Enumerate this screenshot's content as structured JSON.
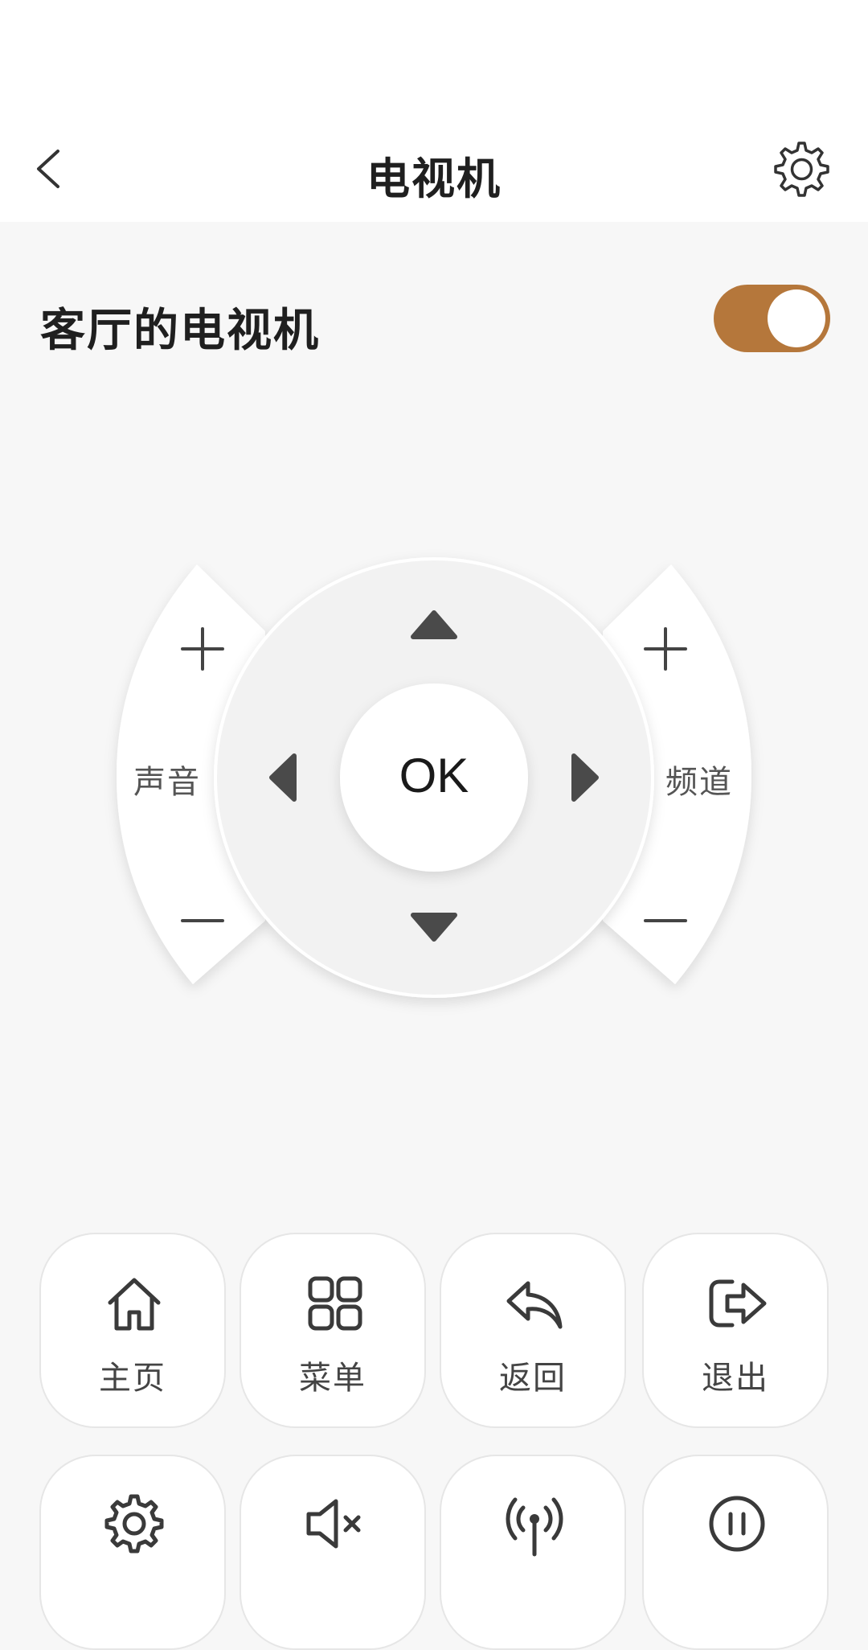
{
  "header": {
    "title": "电视机"
  },
  "device": {
    "name": "客厅的电视机",
    "power_on": true,
    "accent_color": "#b5773b"
  },
  "remote": {
    "volume_label": "声音",
    "channel_label": "频道",
    "ok_label": "OK",
    "plus_symbol": "+",
    "minus_symbol": "—"
  },
  "buttons": [
    {
      "label": "主页",
      "icon": "home-icon"
    },
    {
      "label": "菜单",
      "icon": "menu-grid-icon"
    },
    {
      "label": "返回",
      "icon": "back-arrow-icon"
    },
    {
      "label": "退出",
      "icon": "exit-icon"
    }
  ],
  "buttons_row2": [
    {
      "icon": "settings-icon"
    },
    {
      "icon": "mute-icon"
    },
    {
      "icon": "signal-antenna-icon"
    },
    {
      "icon": "pause-icon"
    }
  ]
}
